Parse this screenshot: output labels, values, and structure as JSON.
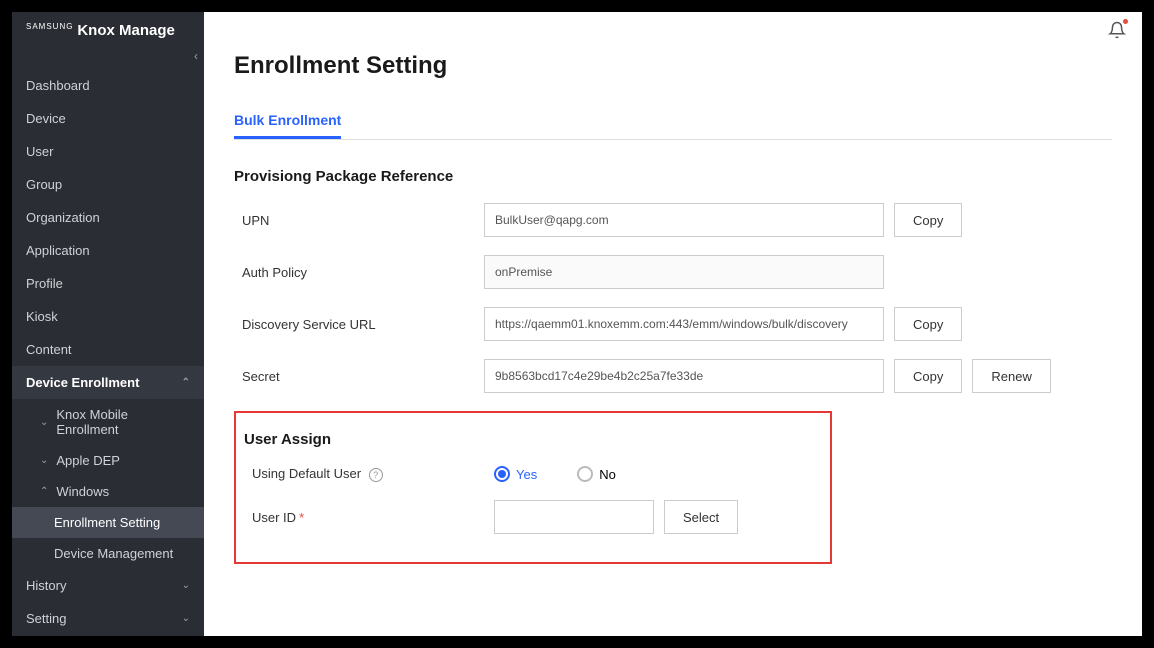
{
  "brand": {
    "prefix": "SAMSUNG",
    "name": "Knox Manage"
  },
  "sidebar": {
    "items": [
      {
        "label": "Dashboard"
      },
      {
        "label": "Device"
      },
      {
        "label": "User"
      },
      {
        "label": "Group"
      },
      {
        "label": "Organization"
      },
      {
        "label": "Application"
      },
      {
        "label": "Profile"
      },
      {
        "label": "Kiosk"
      },
      {
        "label": "Content"
      }
    ],
    "deviceEnrollment": {
      "label": "Device Enrollment",
      "children": [
        {
          "label": "Knox Mobile Enrollment"
        },
        {
          "label": "Apple DEP"
        },
        {
          "label": "Windows",
          "children": [
            {
              "label": "Enrollment Setting"
            },
            {
              "label": "Device Management"
            }
          ]
        }
      ]
    },
    "footer": [
      {
        "label": "History"
      },
      {
        "label": "Setting"
      }
    ]
  },
  "page": {
    "title": "Enrollment Setting",
    "tab": "Bulk Enrollment",
    "section1": {
      "title": "Provisiong Package Reference"
    },
    "upn": {
      "label": "UPN",
      "value": "BulkUser@qapg.com"
    },
    "authPolicy": {
      "label": "Auth Policy",
      "value": "onPremise"
    },
    "discovery": {
      "label": "Discovery Service URL",
      "value": "https://qaemm01.knoxemm.com:443/emm/windows/bulk/discovery"
    },
    "secret": {
      "label": "Secret",
      "value": "9b8563bcd17c4e29be4b2c25a7fe33de"
    },
    "buttons": {
      "copy": "Copy",
      "renew": "Renew",
      "select": "Select"
    },
    "section2": {
      "title": "User Assign"
    },
    "defaultUser": {
      "label": "Using Default User",
      "yes": "Yes",
      "no": "No"
    },
    "userId": {
      "label": "User ID",
      "value": ""
    }
  }
}
